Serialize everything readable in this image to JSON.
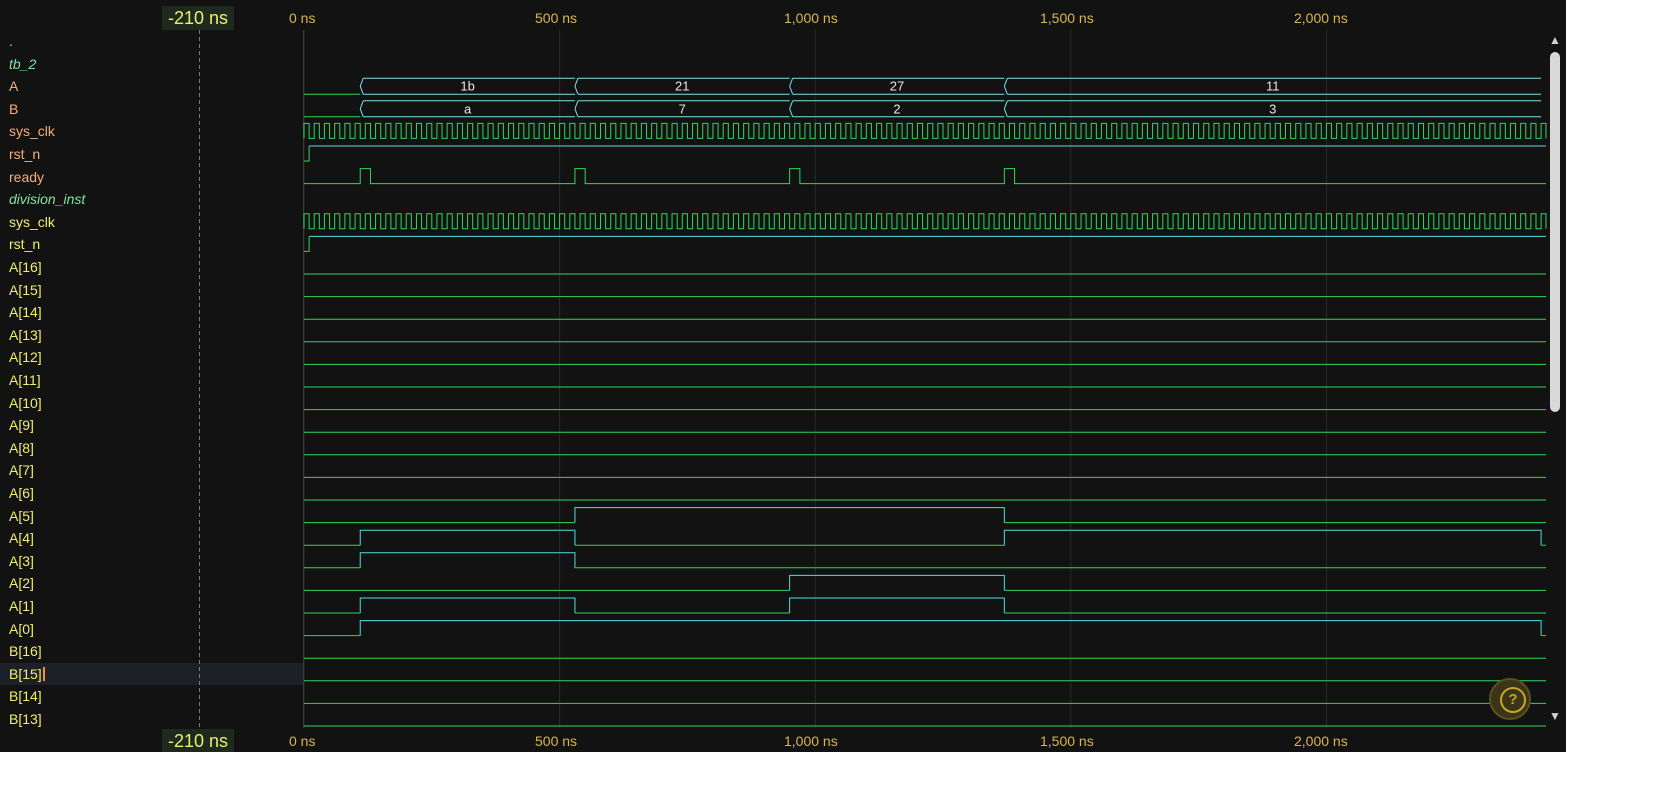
{
  "cursor_time": "-210 ns",
  "ticks": [
    "0 ns",
    "500 ns",
    "1,000 ns",
    "1,500 ns",
    "2,000 ns"
  ],
  "signals": [
    {
      "label": ".",
      "kind": "dot"
    },
    {
      "label": "tb_2",
      "kind": "group"
    },
    {
      "label": "A",
      "kind": "sig-top"
    },
    {
      "label": "B",
      "kind": "sig-top"
    },
    {
      "label": "sys_clk",
      "kind": "sig-top"
    },
    {
      "label": "rst_n",
      "kind": "sig-top"
    },
    {
      "label": "ready",
      "kind": "sig-top"
    },
    {
      "label": "division_inst",
      "kind": "group"
    },
    {
      "label": "sys_clk",
      "kind": "sig"
    },
    {
      "label": "rst_n",
      "kind": "sig"
    },
    {
      "label": "A[16]",
      "kind": "sig"
    },
    {
      "label": "A[15]",
      "kind": "sig"
    },
    {
      "label": "A[14]",
      "kind": "sig"
    },
    {
      "label": "A[13]",
      "kind": "sig"
    },
    {
      "label": "A[12]",
      "kind": "sig"
    },
    {
      "label": "A[11]",
      "kind": "sig"
    },
    {
      "label": "A[10]",
      "kind": "sig"
    },
    {
      "label": "A[9]",
      "kind": "sig"
    },
    {
      "label": "A[8]",
      "kind": "sig"
    },
    {
      "label": "A[7]",
      "kind": "sig"
    },
    {
      "label": "A[6]",
      "kind": "sig"
    },
    {
      "label": "A[5]",
      "kind": "sig"
    },
    {
      "label": "A[4]",
      "kind": "sig"
    },
    {
      "label": "A[3]",
      "kind": "sig"
    },
    {
      "label": "A[2]",
      "kind": "sig"
    },
    {
      "label": "A[1]",
      "kind": "sig"
    },
    {
      "label": "A[0]",
      "kind": "sig"
    },
    {
      "label": "B[16]",
      "kind": "sig"
    },
    {
      "label": "B[15]",
      "kind": "sig"
    },
    {
      "label": "B[14]",
      "kind": "sig"
    },
    {
      "label": "B[13]",
      "kind": "sig"
    }
  ],
  "bus_A": {
    "segments": [
      {
        "start": 110,
        "end": 530,
        "label": "1b"
      },
      {
        "start": 530,
        "end": 950,
        "label": "21"
      },
      {
        "start": 950,
        "end": 1370,
        "label": "27"
      },
      {
        "start": 1370,
        "end": 2420,
        "label": "11"
      }
    ]
  },
  "bus_B": {
    "segments": [
      {
        "start": 110,
        "end": 530,
        "label": "a"
      },
      {
        "start": 530,
        "end": 950,
        "label": "7"
      },
      {
        "start": 950,
        "end": 1370,
        "label": "2"
      },
      {
        "start": 1370,
        "end": 2420,
        "label": "3"
      }
    ]
  },
  "clock_period_ns": 20,
  "ready_pulses": [
    [
      110,
      130
    ],
    [
      530,
      550
    ],
    [
      950,
      970
    ],
    [
      1370,
      1390
    ]
  ],
  "rst_n_rise_ns": 10,
  "bit_highs": {
    "A[5]": [
      [
        530,
        1370
      ]
    ],
    "A[4]": [
      [
        110,
        530
      ],
      [
        1370,
        2420
      ]
    ],
    "A[3]": [
      [
        110,
        530
      ]
    ],
    "A[2]": [
      [
        950,
        1370
      ]
    ],
    "A[1]": [
      [
        110,
        530
      ],
      [
        950,
        1370
      ]
    ],
    "A[0]": [
      [
        110,
        2420
      ]
    ]
  },
  "time_range_ns": [
    -600,
    2420
  ],
  "selected_row": "B[15]",
  "colors": {
    "low_wave": "#2fd65a",
    "high_wave": "#4fdde0",
    "bus": "#7fe0ea",
    "tick_text": "#d8b84e",
    "cursor_text": "#e8f06a"
  },
  "icons": {
    "help": "question-icon",
    "scroll_up": "triangle-up-icon",
    "scroll_down": "triangle-down-icon"
  }
}
